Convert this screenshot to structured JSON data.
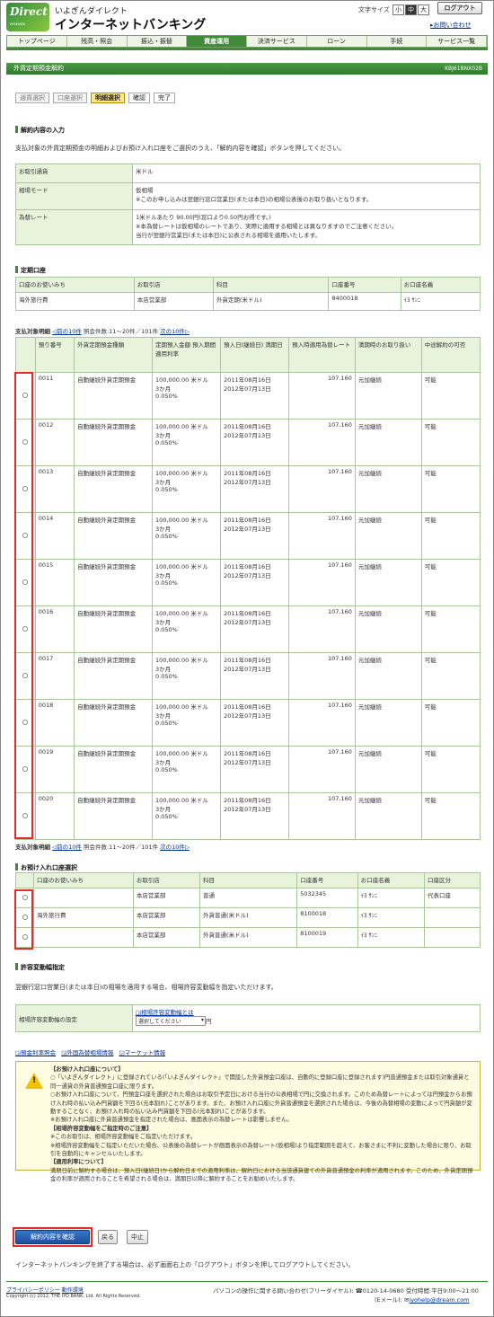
{
  "brand": {
    "sub": "いよぎんダイレクト",
    "main": "インターネットバンキング",
    "logo": "Direct"
  },
  "font_size": {
    "label": "文字サイズ",
    "small": "小",
    "medium": "中",
    "large": "大"
  },
  "logout": "ログアウト",
  "contact": "お問い合わせ",
  "nav": [
    "トップページ",
    "残高・照会",
    "振込・振替",
    "資産運用",
    "決済サービス",
    "ローン",
    "手続",
    "サービス一覧"
  ],
  "page_title": "外貨定期預金解約",
  "page_id": "KBJ61BNX02B",
  "steps": [
    "通貨選択",
    "口座選択",
    "明細選択",
    "確認",
    "完了"
  ],
  "section1": {
    "title": "解約内容の入力",
    "desc": "支払対象の外貨定期預金の明細およびお預け入れ口座をご選択のうえ、「解約内容を確認」ボタンを押してください。"
  },
  "info": {
    "currency_label": "お取引通貨",
    "currency_value": "米ドル",
    "market_label": "相場モード",
    "market_value1": "仮相場",
    "market_value2": "※このお申し込みは翌銀行窓口営業日(または本日)の相場公表後のお取り扱いとなります。",
    "rate_label": "為替レート",
    "rate_value1": "1米ドルあたり 90.00円(窓口より0.50円お得です。)",
    "rate_value2": "※本為替レートは仮相場のレートであり、実際に適用する相場とは異なりますのでご注意ください。",
    "rate_value3": "当行が翌銀行営業日(または本日)に公表される相場を適用いたします。"
  },
  "fixed_account": {
    "title": "定期口座",
    "headers": [
      "口座のお使いみち",
      "お取引店",
      "科目",
      "口座番号",
      "お口座名義"
    ],
    "row": [
      "海外旅行費",
      "本店営業部",
      "外貨定期(米ドル)",
      "8400018",
      "ｲﾖ ｻﾝﾆ"
    ]
  },
  "pager": {
    "label": "支払対象明細",
    "prev": "前の10件",
    "info": "照会件数:11〜20件／101件",
    "next": "次の10件"
  },
  "detail_headers": [
    "預り番号",
    "外貨定期預金種類",
    "定期預入金額 預入期間 適用利率",
    "預入日(継続日) 満期日",
    "預入時適用為替レート",
    "満期時のお取り扱い",
    "中途解約の可否"
  ],
  "details": [
    {
      "no": "0011",
      "type": "自動継続外貨定期預金",
      "amount": "100,000.00 米ドル",
      "period": "3か月",
      "rate": "0.050%",
      "date1": "2011年08月16日",
      "date2": "2012年07月13日",
      "fx": "107.160",
      "maturity": "元加継続",
      "cancel": "可能"
    },
    {
      "no": "0012",
      "type": "自動継続外貨定期預金",
      "amount": "100,000.00 米ドル",
      "period": "3か月",
      "rate": "0.050%",
      "date1": "2011年08月16日",
      "date2": "2012年07月13日",
      "fx": "107.160",
      "maturity": "元加継続",
      "cancel": "可能"
    },
    {
      "no": "0013",
      "type": "自動継続外貨定期預金",
      "amount": "100,000.00 米ドル",
      "period": "3か月",
      "rate": "0.050%",
      "date1": "2011年08月16日",
      "date2": "2012年07月13日",
      "fx": "107.160",
      "maturity": "元加継続",
      "cancel": "可能"
    },
    {
      "no": "0014",
      "type": "自動継続外貨定期預金",
      "amount": "100,000.00 米ドル",
      "period": "3か月",
      "rate": "0.050%",
      "date1": "2011年08月16日",
      "date2": "2012年07月13日",
      "fx": "107.160",
      "maturity": "元加継続",
      "cancel": "可能"
    },
    {
      "no": "0015",
      "type": "自動継続外貨定期預金",
      "amount": "100,000.00 米ドル",
      "period": "3か月",
      "rate": "0.050%",
      "date1": "2011年08月16日",
      "date2": "2012年07月13日",
      "fx": "107.160",
      "maturity": "元加継続",
      "cancel": "可能"
    },
    {
      "no": "0016",
      "type": "自動継続外貨定期預金",
      "amount": "100,000.00 米ドル",
      "period": "3か月",
      "rate": "0.050%",
      "date1": "2011年08月16日",
      "date2": "2012年07月13日",
      "fx": "107.160",
      "maturity": "元加継続",
      "cancel": "可能"
    },
    {
      "no": "0017",
      "type": "自動継続外貨定期預金",
      "amount": "100,000.00 米ドル",
      "period": "3か月",
      "rate": "0.050%",
      "date1": "2011年08月16日",
      "date2": "2012年07月13日",
      "fx": "107.160",
      "maturity": "元加継続",
      "cancel": "可能"
    },
    {
      "no": "0018",
      "type": "自動継続外貨定期預金",
      "amount": "100,000.00 米ドル",
      "period": "3か月",
      "rate": "0.050%",
      "date1": "2011年08月16日",
      "date2": "2012年07月13日",
      "fx": "107.160",
      "maturity": "元加継続",
      "cancel": "可能"
    },
    {
      "no": "0019",
      "type": "自動継続外貨定期預金",
      "amount": "100,000.00 米ドル",
      "period": "3か月",
      "rate": "0.050%",
      "date1": "2011年08月16日",
      "date2": "2012年07月13日",
      "fx": "107.160",
      "maturity": "元加継続",
      "cancel": "可能"
    },
    {
      "no": "0020",
      "type": "自動継続外貨定期預金",
      "amount": "100,000.00 米ドル",
      "period": "3か月",
      "rate": "0.050%",
      "date1": "2011年08月16日",
      "date2": "2012年07月13日",
      "fx": "107.160",
      "maturity": "元加継続",
      "cancel": "可能"
    }
  ],
  "deposit": {
    "title": "お預け入れ口座選択",
    "headers": [
      "口座のお使いみち",
      "お取引店",
      "科目",
      "口座番号",
      "お口座名義",
      "口座区分"
    ],
    "rows": [
      [
        "",
        "本店営業部",
        "普通",
        "5032345",
        "ｲﾖ ｻﾝﾆ",
        "代表口座"
      ],
      [
        "海外旅行費",
        "本店営業部",
        "外貨普通(米ドル)",
        "8100018",
        "ｲﾖ ｻﾝﾆ",
        ""
      ],
      [
        "",
        "本店営業部",
        "外貨普通(米ドル)",
        "8100019",
        "ｲﾖ ｻﾝﾆ",
        ""
      ]
    ]
  },
  "tolerance": {
    "title": "許容変動幅指定",
    "desc": "翌銀行窓口営業日(または本日)の相場を適用する場合、相場許容変動幅を指定いただけます。",
    "label": "相場許容変動幅の設定",
    "link": "相場許容変動幅とは",
    "select": "選択してください",
    "unit": "円"
  },
  "links": [
    "預金利率照会",
    "外国為替相場情報",
    "マーケット情報"
  ],
  "notice": [
    "【お預け入れ口座について】",
    "○「いよぎんダイレクト」に登録されている(「いよぎんダイレクト」で開設した外貨預金口座は、自動的に登録口座に登録されます)円普通預金または取引対象通貨と同一通貨の外貨普通預金口座に限ります。",
    "○お預け入れ口座について、円預金口座を選択された場合はお取引予定日における当行の公表相場で円に交換されます。このため為替レートによっては円預金からお預け入れ時の払い込み円貨額を下回る(元本割れ)ことがあります。また、お預け入れ口座に外貨普通預金を選択された場合は、今後の為替相場の変動によって円貨額が変動することなく、お預け入れ時の払い込み円貨額を下回る(元本割れ)ことがあります。",
    "※お預け入れ口座に外貨普通預金を指定された場合は、画面表示の為替レートは影響しません。",
    "【相場許容変動幅をご指定時のご注意】",
    "※このお取引は、相場許容変動幅をご指定いただけます。",
    "※相場許容変動幅をご指定いただいた場合、公表後の為替レートが画面表示の為替レート(仮相場)より指定範囲を超えて、お客さまに不利に変動した場合に限り、お取引を自動的にキャンセルいたします。",
    "【適用利率について】",
    "満期日前に解約する場合は、預入日(継続日)から解約日までの適用利率は、解約日における当該通貨建ての外貨普通預金の利率が適用されます。このため、外貨定期預金の利率が適用されることを希望される場合は、満期日以降に解約することをお勧めいたします。"
  ],
  "buttons": {
    "confirm": "解約内容を確認",
    "back": "戻る",
    "cancel": "中止"
  },
  "logout_note": "インターネットバンキングを終了する場合は、必ず画面右上の「ログアウト」ボタンを押してログアウトしてください。",
  "footer": {
    "privacy": "プライバシーポリシー",
    "security": "動作環境",
    "copyright": "Copyright (c) 2012, THE IYO BANK, Ltd. All Rights Reserved.",
    "inquiry": "パソコンの操作に関する問い合わせ(フリーダイヤル):",
    "phone": "0120-14-0680 受付時間:平日9:00〜21:00",
    "email_label": "(Eメール):",
    "email": "iyohelp@dream.com"
  }
}
